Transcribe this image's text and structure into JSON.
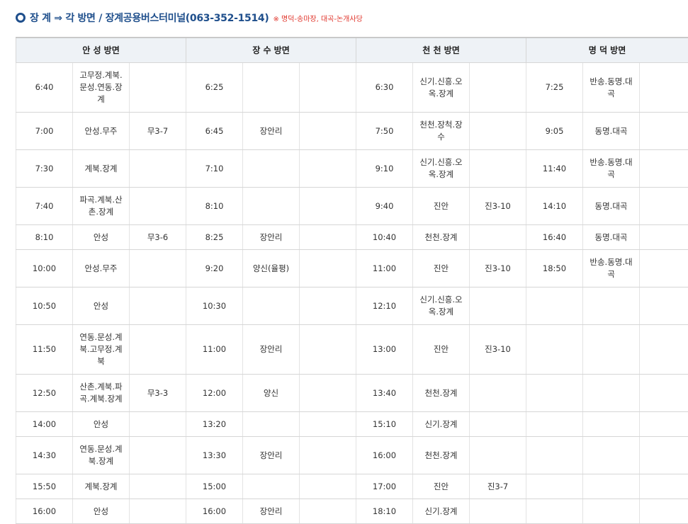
{
  "title": {
    "main": "장 계 ⇒ 각 방면 / 장계공용버스터미널(063-352-1514)",
    "note": "※ 명덕-송마장, 대곡-논개사당"
  },
  "headers": [
    "안 성 방면",
    "장 수 방면",
    "천 천 방면",
    "명 덕 방면"
  ],
  "rows": [
    [
      "6:40",
      "고무정.계북.문성.연동.장계",
      "",
      "6:25",
      "",
      "",
      "6:30",
      "신기.신흥.오옥.장계",
      "",
      "7:25",
      "반송.동명.대곡",
      ""
    ],
    [
      "7:00",
      "안성.무주",
      "무3-7",
      "6:45",
      "장안리",
      "",
      "7:50",
      "천천.장척.장수",
      "",
      "9:05",
      "동명.대곡",
      ""
    ],
    [
      "7:30",
      "계북.장계",
      "",
      "7:10",
      "",
      "",
      "9:10",
      "신기.신흥.오옥.장계",
      "",
      "11:40",
      "반송.동명.대곡",
      ""
    ],
    [
      "7:40",
      "파곡.계북.산촌.장계",
      "",
      "8:10",
      "",
      "",
      "9:40",
      "진안",
      "진3-10",
      "14:10",
      "동명.대곡",
      ""
    ],
    [
      "8:10",
      "안성",
      "무3-6",
      "8:25",
      "장안리",
      "",
      "10:40",
      "천천.장계",
      "",
      "16:40",
      "동명.대곡",
      ""
    ],
    [
      "10:00",
      "안성.무주",
      "",
      "9:20",
      "양신(율평)",
      "",
      "11:00",
      "진안",
      "진3-10",
      "18:50",
      "반송.동명.대곡",
      ""
    ],
    [
      "10:50",
      "안성",
      "",
      "10:30",
      "",
      "",
      "12:10",
      "신기.신흥.오옥.장계",
      "",
      "",
      "",
      ""
    ],
    [
      "11:50",
      "연동.문성.계북.고무정.계북",
      "",
      "11:00",
      "장안리",
      "",
      "13:00",
      "진안",
      "진3-10",
      "",
      "",
      ""
    ],
    [
      "12:50",
      "산촌.계북.파곡.계북.장계",
      "무3-3",
      "12:00",
      "양신",
      "",
      "13:40",
      "천천.장계",
      "",
      "",
      "",
      ""
    ],
    [
      "14:00",
      "안성",
      "",
      "13:20",
      "",
      "",
      "15:10",
      "신기.장계",
      "",
      "",
      "",
      ""
    ],
    [
      "14:30",
      "연동.문성.계북.장계",
      "",
      "13:30",
      "장안리",
      "",
      "16:00",
      "천천.장계",
      "",
      "",
      "",
      ""
    ],
    [
      "15:50",
      "계북.장계",
      "",
      "15:00",
      "",
      "",
      "17:00",
      "진안",
      "진3-7",
      "",
      "",
      ""
    ],
    [
      "16:00",
      "안성",
      "",
      "16:00",
      "장안리",
      "",
      "18:10",
      "신기.장계",
      "",
      "",
      "",
      ""
    ]
  ]
}
